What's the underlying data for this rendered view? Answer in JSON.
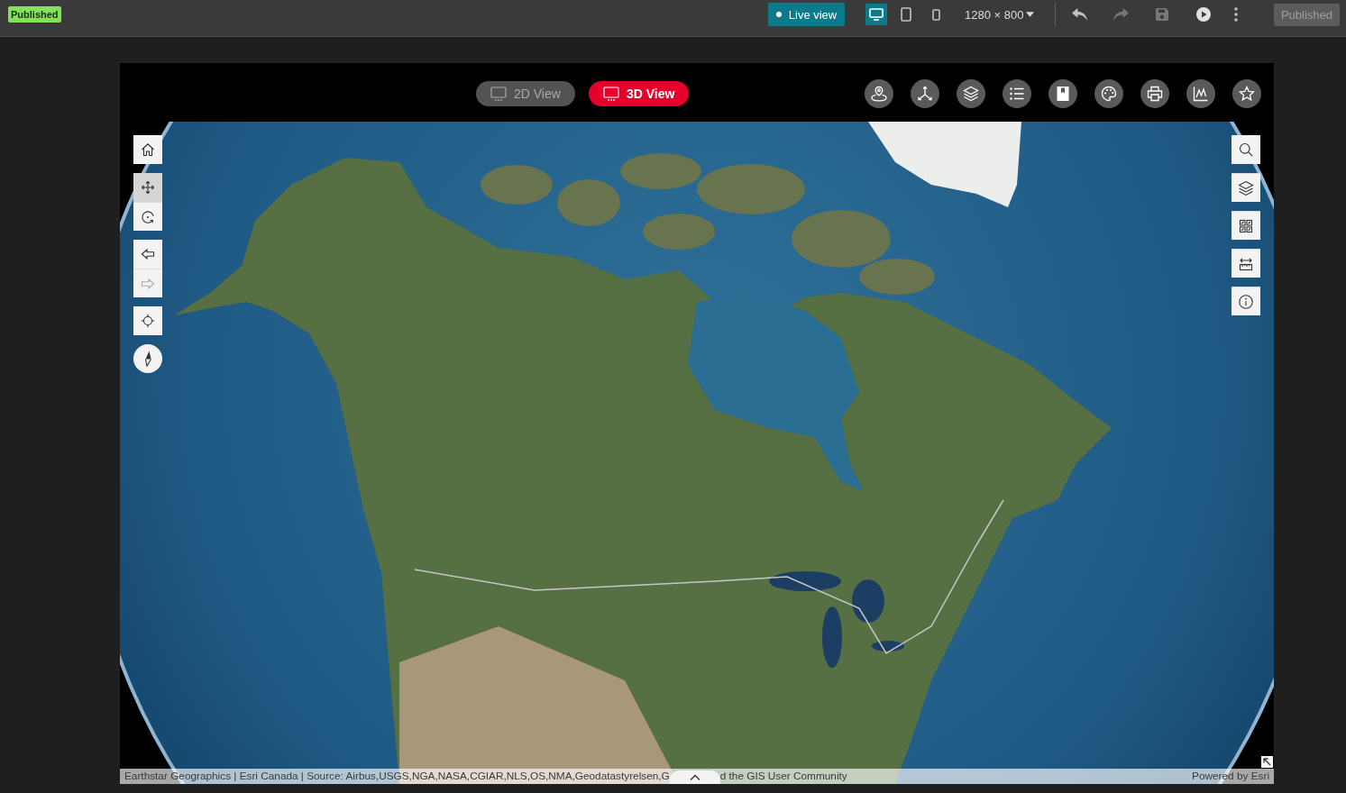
{
  "top_bar": {
    "status_badge": "Published",
    "live_view_button": "Live view",
    "devices": [
      {
        "kind": "desktop",
        "selected": true
      },
      {
        "kind": "tablet",
        "selected": false
      },
      {
        "kind": "phone",
        "selected": false
      }
    ],
    "screen_size": "1280 × 800",
    "actions": [
      {
        "kind": "undo",
        "disabled": false
      },
      {
        "kind": "redo",
        "disabled": true
      },
      {
        "kind": "save",
        "disabled": true
      },
      {
        "kind": "preview",
        "disabled": false
      },
      {
        "kind": "more",
        "disabled": false
      }
    ],
    "publish_button": {
      "label": "Published",
      "disabled": true
    }
  },
  "app": {
    "view_tabs": [
      {
        "label": "2D View",
        "selected": false
      },
      {
        "label": "3D View",
        "selected": true
      }
    ],
    "widgets": [
      {
        "kind": "pin"
      },
      {
        "kind": "axes"
      },
      {
        "kind": "layers"
      },
      {
        "kind": "list"
      },
      {
        "kind": "bookmark"
      },
      {
        "kind": "palette"
      },
      {
        "kind": "print"
      },
      {
        "kind": "chart"
      },
      {
        "kind": "star"
      }
    ],
    "map": {
      "left_tools": [
        {
          "tools": [
            {
              "kind": "home"
            }
          ]
        },
        {
          "tools": [
            {
              "kind": "pan",
              "selected": true
            },
            {
              "kind": "rotate",
              "selected": false
            }
          ]
        },
        {
          "tools": [
            {
              "kind": "back",
              "disabled": false
            },
            {
              "kind": "forward",
              "disabled": true
            }
          ]
        },
        {
          "tools": [
            {
              "kind": "locate"
            }
          ]
        },
        {
          "tools": [
            {
              "kind": "compass"
            }
          ]
        }
      ],
      "right_tools": [
        {
          "kind": "search"
        },
        {
          "kind": "layers"
        },
        {
          "kind": "basemap"
        },
        {
          "kind": "measure"
        },
        {
          "kind": "info"
        }
      ],
      "attribution": {
        "texts": [
          "Earthstar Geographics | Esri Canada | Source: Airbus,USGS,NGA,NASA,CGIAR,NLS,OS,NMA,Geodatastyrelsen,G",
          "d the GIS User Community"
        ],
        "powered_by": "Powered by Esri"
      }
    }
  }
}
